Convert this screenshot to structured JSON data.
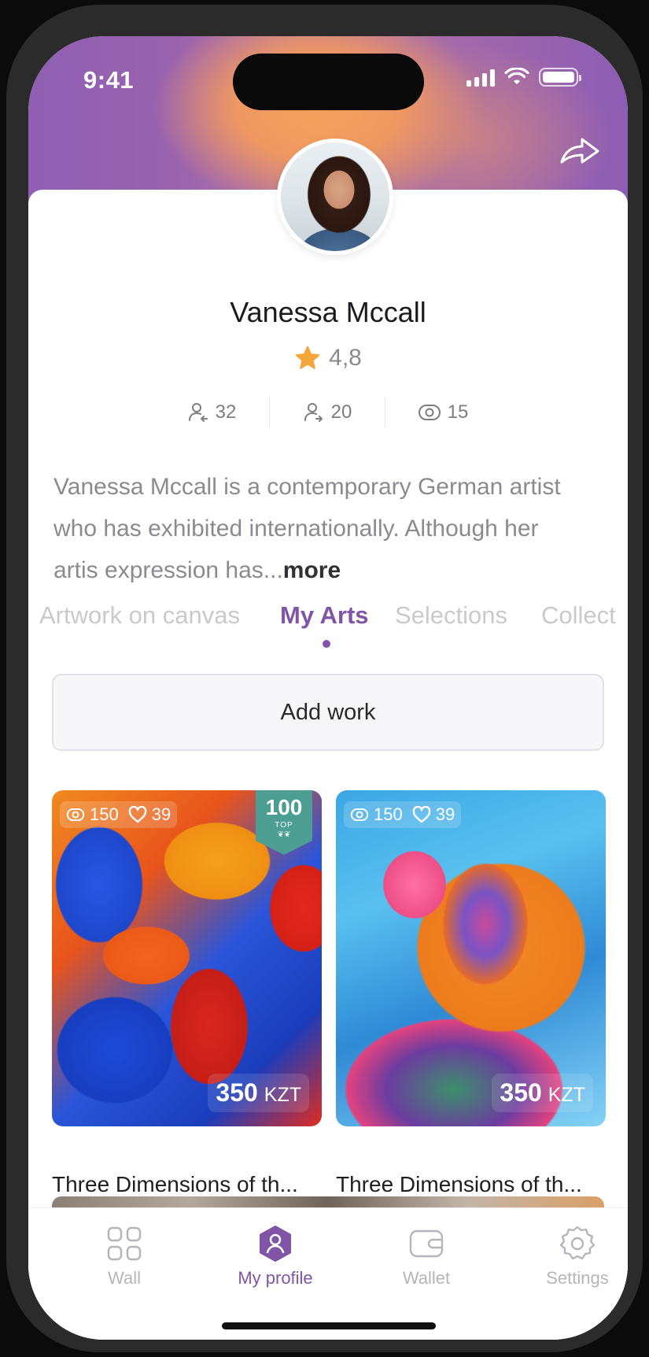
{
  "status_bar": {
    "time": "9:41"
  },
  "profile": {
    "name": "Vanessa Mccall",
    "rating": "4,8",
    "stats": {
      "followers": "32",
      "following": "20",
      "views": "15"
    },
    "bio_text": "Vanessa Mccall is a contemporary German artist who has exhibited internationally. Although her artis expression has...",
    "bio_more": "more"
  },
  "tabs": [
    {
      "label": "Artwork on canvas",
      "active": false
    },
    {
      "label": "My Arts",
      "active": true
    },
    {
      "label": "Selections",
      "active": false
    },
    {
      "label": "Collect",
      "active": false
    }
  ],
  "add_work_label": "Add work",
  "artworks": [
    {
      "views": "150",
      "likes": "39",
      "badge_number": "100",
      "badge_label": "TOP",
      "price": "350",
      "currency": "KZT",
      "title": "Three Dimensions of th..."
    },
    {
      "views": "150",
      "likes": "39",
      "price": "350",
      "currency": "KZT",
      "title": "Three Dimensions of th..."
    }
  ],
  "bottom_nav": [
    {
      "label": "Wall",
      "icon": "grid-icon",
      "active": false
    },
    {
      "label": "My profile",
      "icon": "profile-icon",
      "active": true
    },
    {
      "label": "Wallet",
      "icon": "wallet-icon",
      "active": false
    },
    {
      "label": "Settings",
      "icon": "gear-icon",
      "active": false
    }
  ],
  "colors": {
    "accent": "#8055a8",
    "star": "#f4a63a",
    "badge": "#4c9e92"
  }
}
